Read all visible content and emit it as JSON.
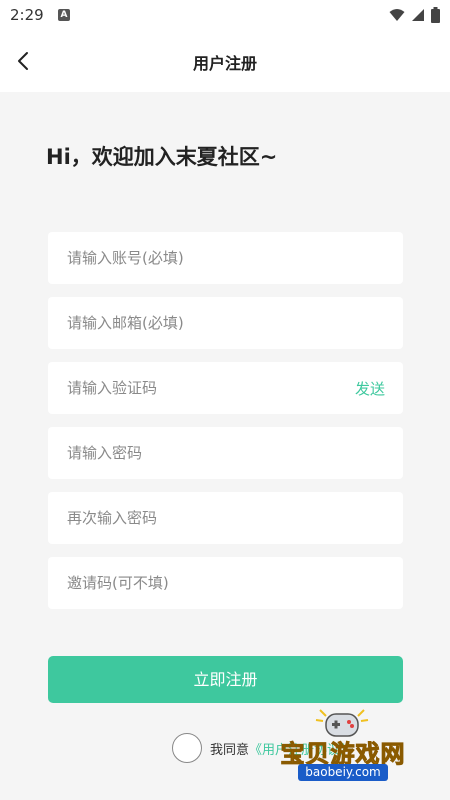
{
  "status_bar": {
    "time": "2:29",
    "notification_icon": "a-icon",
    "icons": [
      "wifi-icon",
      "signal-icon",
      "battery-icon"
    ]
  },
  "header": {
    "title": "用户注册",
    "back_icon": "chevron-left-icon"
  },
  "welcome": "Hi，欢迎加入末夏社区~",
  "form": {
    "account_placeholder": "请输入账号(必填)",
    "email_placeholder": "请输入邮箱(必填)",
    "code_placeholder": "请输入验证码",
    "send_label": "发送",
    "password_placeholder": "请输入密码",
    "confirm_password_placeholder": "再次输入密码",
    "invite_placeholder": "邀请码(可不填)",
    "register_label": "立即注册"
  },
  "agreement": {
    "prefix": "我同意",
    "link": "《用户注册协议》"
  },
  "watermark": {
    "name": "宝贝游戏网",
    "url": "baobeiy.com"
  },
  "colors": {
    "accent": "#3ec89e",
    "background": "#f5f5f5",
    "field": "#ffffff"
  }
}
